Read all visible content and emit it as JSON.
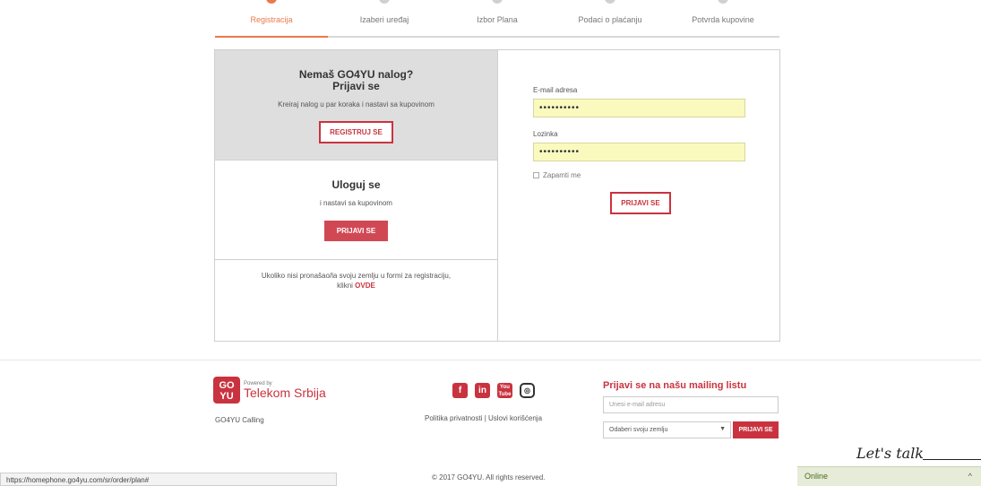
{
  "steps": [
    {
      "label": "Registracija",
      "active": true
    },
    {
      "label": "Izaberi uređaj",
      "active": false
    },
    {
      "label": "Izbor Plana",
      "active": false
    },
    {
      "label": "Podaci o plaćanju",
      "active": false
    },
    {
      "label": "Potvrda kupovine",
      "active": false
    }
  ],
  "register": {
    "title_line1": "Nemaš GO4YU nalog?",
    "title_line2": "Prijavi se",
    "subtitle": "Kreiraj nalog u par koraka i nastavi sa kupovinom",
    "button": "REGISTRUJ SE"
  },
  "login_panel": {
    "title": "Uloguj se",
    "subtitle": "i nastavi sa kupovinom",
    "button": "PRIJAVI SE"
  },
  "not_found": {
    "text": "Ukoliko nisi pronašao/la svoju zemlju u formi za registraciju,",
    "text2": "klikni",
    "link": "OVDE"
  },
  "form": {
    "email_label": "E-mail adresa",
    "email_value": "••••••••••",
    "password_label": "Lozinka",
    "password_value": "••••••••••",
    "remember_label": "Zapamti me",
    "submit": "PRIJAVI SE"
  },
  "footer": {
    "logo_text_1": "GO",
    "logo_text_2": "YU",
    "powered_by": "Powered by",
    "brand": "Telekom Srbija",
    "calling": "GO4YU Calling",
    "socials": [
      "f",
      "in",
      "You Tube",
      "◎"
    ],
    "links": "Politika privatnosti | Uslovi korišćenja",
    "mailing_title": "Prijavi se na našu mailing listu",
    "mailing_placeholder": "Unesi e-mail adresu",
    "country_select": "Odaberi svoju zemlju",
    "mailing_button": "PRIJAVI SE",
    "copyright": "© 2017 GO4YU. All rights reserved."
  },
  "lets_talk": "Let's talk",
  "status_url": "https://homephone.go4yu.com/sr/order/plan#",
  "chat": {
    "status": "Online"
  },
  "colors": {
    "accent": "#c9333f",
    "step_active": "#ea7a4a",
    "input_bg": "#fafabf"
  }
}
